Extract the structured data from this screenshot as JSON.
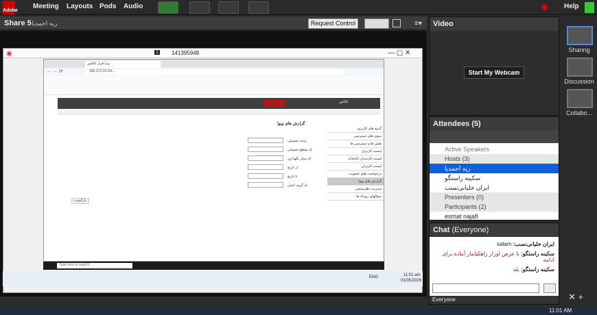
{
  "top": {
    "menus": [
      "Meeting",
      "Layouts",
      "Pods",
      "Audio"
    ],
    "help": "Help",
    "adobe": "Adobe"
  },
  "share": {
    "title": "Share 5",
    "presenter": "ریه احمدیا",
    "request": "Request Control"
  },
  "remote": {
    "id": "141395948",
    "url": "192.172.10.16/…",
    "title": "نرم افزار کلکتور"
  },
  "page": {
    "fields": [
      "رشته تحصیلی",
      "کد مقطع تحصیلی",
      "کد محل نگهداری",
      "از تاریخ",
      "تا تاریخ",
      "کد گروه اعتبار"
    ],
    "submit": "بازگشت",
    "panel_title": "گزارش های ویوا",
    "menu": [
      "گروه های کاربری",
      "منوی های دسترسی",
      "نقش ها و دسترسی ها",
      "لیست کاربران",
      "لیست کارمندان کتابخانه",
      "لیست کاربران",
      "درخواست های عضویت",
      "درخواستها",
      "گزارش های ویوا",
      "مدیریت نظرسنجی",
      "سوالهای رویداد ها"
    ]
  },
  "clock": {
    "time": "11:01 am",
    "date": "01/05/2026",
    "lang": "ENG",
    "search": "Type here to search"
  },
  "video": {
    "title": "Video",
    "webcam": "Start My Webcam"
  },
  "attendees": {
    "title": "Attendees",
    "count": "(5)",
    "active": "Active Speakers",
    "hosts": "Hosts (3)",
    "host_list": [
      "ریه احمدیا",
      "سکینه راستگو",
      "ایران خلیانی‌نسب"
    ],
    "presenters": "Presenters (0)",
    "participants": "Participants (2)",
    "participant_list": [
      "esmat najafi"
    ]
  },
  "chat": {
    "title": "Chat",
    "scope": "(Everyone)",
    "messages": [
      {
        "who": "ایران خلیانی‌نسب:",
        "text": "salam",
        "color": "#222"
      },
      {
        "who": "سکینه راستگو:",
        "text": "با عرض اوزار زاهکیامار آماده برای ادامه",
        "color": "#b02020"
      },
      {
        "who": "سکینه راستگو:",
        "text": "بله",
        "color": "#b02020"
      }
    ],
    "everyone": "Everyone"
  },
  "sidebar": {
    "items": [
      "Sharing",
      "Discussion",
      "Collabo..."
    ]
  },
  "wintask_time": "11:01 AM"
}
